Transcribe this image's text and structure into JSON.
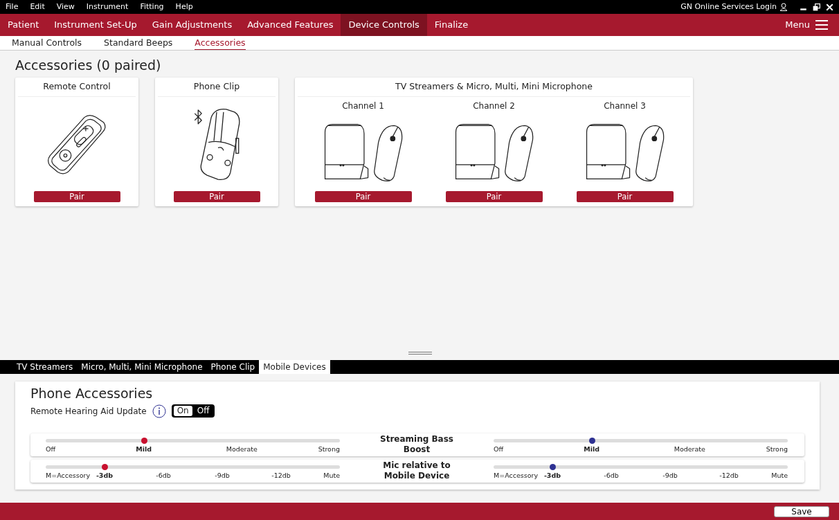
{
  "menu_bar": {
    "items": [
      "File",
      "Edit",
      "View",
      "Instrument",
      "Fitting",
      "Help"
    ],
    "login": "GN Online Services Login"
  },
  "main_nav": {
    "items": [
      {
        "label": "Patient",
        "selected": false
      },
      {
        "label": "Instrument Set-Up",
        "selected": false
      },
      {
        "label": "Gain Adjustments",
        "selected": false
      },
      {
        "label": "Advanced Features",
        "selected": false
      },
      {
        "label": "Device Controls",
        "selected": true
      },
      {
        "label": "Finalize",
        "selected": false
      }
    ],
    "menu": "Menu"
  },
  "sub_nav": [
    {
      "label": "Manual Controls",
      "selected": false
    },
    {
      "label": "Standard Beeps",
      "selected": false
    },
    {
      "label": "Accessories",
      "selected": true
    }
  ],
  "page_title": "Accessories (0 paired)",
  "accessories": [
    {
      "title": "Remote Control",
      "kind": "remote",
      "channels": [
        {
          "button": "Pair"
        }
      ]
    },
    {
      "title": "Phone Clip",
      "kind": "clip",
      "channels": [
        {
          "button": "Pair"
        }
      ]
    },
    {
      "title": "TV Streamers & Micro, Multi, Mini Microphone",
      "kind": "streamer",
      "channels": [
        {
          "label": "Channel 1",
          "button": "Pair"
        },
        {
          "label": "Channel 2",
          "button": "Pair"
        },
        {
          "label": "Channel 3",
          "button": "Pair"
        }
      ]
    }
  ],
  "bottom_tabs": [
    {
      "label": "TV Streamers",
      "selected": false
    },
    {
      "label": "Micro, Multi, Mini Microphone",
      "selected": false
    },
    {
      "label": "Phone Clip",
      "selected": false
    },
    {
      "label": "Mobile Devices",
      "selected": true
    }
  ],
  "panel": {
    "title": "Phone Accessories",
    "update_label": "Remote Hearing Aid Update",
    "toggle": [
      {
        "label": "On",
        "selected": true
      },
      {
        "label": "Off",
        "selected": false
      }
    ],
    "settings": [
      {
        "label": "Streaming Bass Boost",
        "sliders": [
          {
            "color": "#c8102e",
            "stops": [
              {
                "label": "Off",
                "selected": false
              },
              {
                "label": "Mild",
                "selected": true
              },
              {
                "label": "Moderate",
                "selected": false
              },
              {
                "label": "Strong",
                "selected": false
              }
            ]
          },
          {
            "color": "#2e3192",
            "stops": [
              {
                "label": "Off",
                "selected": false
              },
              {
                "label": "Mild",
                "selected": true
              },
              {
                "label": "Moderate",
                "selected": false
              },
              {
                "label": "Strong",
                "selected": false
              }
            ]
          }
        ]
      },
      {
        "label": "Mic relative to Mobile Device",
        "sliders": [
          {
            "color": "#c8102e",
            "stops": [
              {
                "label": "M=Accessory",
                "selected": false
              },
              {
                "label": "-3db",
                "selected": true
              },
              {
                "label": "-6db",
                "selected": false
              },
              {
                "label": "-9db",
                "selected": false
              },
              {
                "label": "-12db",
                "selected": false
              },
              {
                "label": "Mute",
                "selected": false
              }
            ]
          },
          {
            "color": "#2e3192",
            "stops": [
              {
                "label": "M=Accessory",
                "selected": false
              },
              {
                "label": "-3db",
                "selected": true
              },
              {
                "label": "-6db",
                "selected": false
              },
              {
                "label": "-9db",
                "selected": false
              },
              {
                "label": "-12db",
                "selected": false
              },
              {
                "label": "Mute",
                "selected": false
              }
            ]
          }
        ]
      }
    ]
  },
  "footer": {
    "save": "Save"
  }
}
